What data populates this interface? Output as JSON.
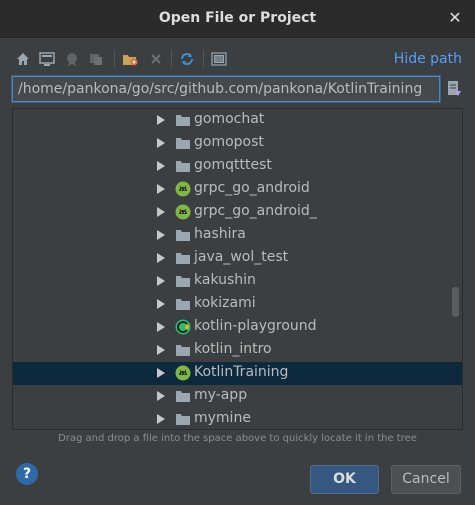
{
  "window": {
    "title": "Open File or Project"
  },
  "toolbar": {
    "icons": [
      "home-icon",
      "desktop-icon",
      "project-icon",
      "module-icon",
      "new-folder-icon",
      "delete-icon",
      "refresh-icon",
      "show-hidden-icon"
    ],
    "hide_path_label": "Hide path"
  },
  "path": {
    "value": "/home/pankona/go/src/github.com/pankona/KotlinTraining"
  },
  "tree": {
    "items": [
      {
        "label": "gomochat",
        "icon": "folder-icon"
      },
      {
        "label": "gomopost",
        "icon": "folder-icon"
      },
      {
        "label": "gomqtttest",
        "icon": "folder-icon"
      },
      {
        "label": "grpc_go_android",
        "icon": "android-icon"
      },
      {
        "label": "grpc_go_android_",
        "icon": "android-icon"
      },
      {
        "label": "hashira",
        "icon": "folder-icon"
      },
      {
        "label": "java_wol_test",
        "icon": "folder-icon"
      },
      {
        "label": "kakushin",
        "icon": "folder-icon"
      },
      {
        "label": "kokizami",
        "icon": "folder-icon"
      },
      {
        "label": "kotlin-playground",
        "icon": "intellij-project-icon"
      },
      {
        "label": "kotlin_intro",
        "icon": "folder-icon"
      },
      {
        "label": "KotlinTraining",
        "icon": "android-icon",
        "selected": true
      },
      {
        "label": "my-app",
        "icon": "folder-icon"
      },
      {
        "label": "mymine",
        "icon": "folder-icon"
      }
    ]
  },
  "hint": "Drag and drop a file into the space above to quickly locate it in the tree",
  "buttons": {
    "help": "?",
    "ok": "OK",
    "cancel": "Cancel"
  }
}
